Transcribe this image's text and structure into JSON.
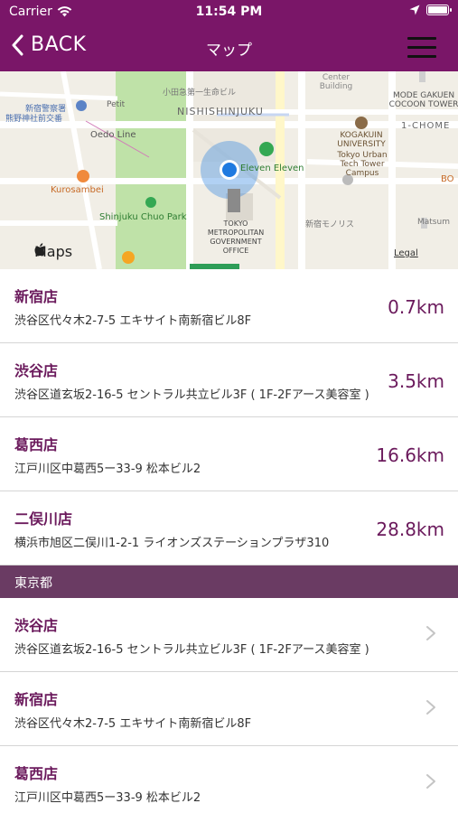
{
  "status_bar": {
    "carrier": "Carrier",
    "time": "11:54 PM"
  },
  "nav": {
    "back_label": "BACK",
    "title": "マップ"
  },
  "map": {
    "labels": {
      "station_police": "新宿警察署",
      "kumano": "熊野神社前交番",
      "petit": "Petit",
      "odakyu": "小田急第一生命ビル",
      "nishishinjuku": "NISHISHINJUKU",
      "center_building": "Center Building",
      "mode_gakuen": "MODE GAKUEN COCOON TOWER",
      "oedo": "Oedo Line",
      "chome": "1-CHOME",
      "kogakuin": "KOGAKUIN UNIVERSITY",
      "tokyo_urban": "Tokyo Urban Tech Tower Campus",
      "eleven": "Eleven Eleven",
      "kurosambei": "Kurosambei",
      "park": "Shinjuku Chuo Park",
      "tmg": "TOKYO METROPOLITAN GOVERNMENT OFFICE",
      "monolith": "新宿モノリス",
      "matsum": "Matsum",
      "bo": "BO",
      "maps": "Maps",
      "legal": "Legal"
    }
  },
  "nearby": [
    {
      "name": "新宿店",
      "address": "渋谷区代々木2-7-5 エキサイト南新宿ビル8F",
      "distance": "0.7km"
    },
    {
      "name": "渋谷店",
      "address": "渋谷区道玄坂2-16-5 セントラル共立ビル3F ( 1F-2Fアース美容室 )",
      "distance": "3.5km"
    },
    {
      "name": "葛西店",
      "address": "江戸川区中葛西5ー33-9 松本ビル2",
      "distance": "16.6km"
    },
    {
      "name": "二俣川店",
      "address": "横浜市旭区二俣川1-2-1 ライオンズステーションプラザ310",
      "distance": "28.8km"
    }
  ],
  "section": {
    "title": "東京都"
  },
  "region_stores": [
    {
      "name": "渋谷店",
      "address": "渋谷区道玄坂2-16-5 セントラル共立ビル3F ( 1F-2Fアース美容室 )"
    },
    {
      "name": "新宿店",
      "address": "渋谷区代々木2-7-5 エキサイト南新宿ビル8F"
    },
    {
      "name": "葛西店",
      "address": "江戸川区中葛西5ー33-9 松本ビル2"
    }
  ],
  "colors": {
    "brand": "#7a1668",
    "section": "#6a3b63",
    "accent_text": "#6b1a5c",
    "location": "#1f7ae0"
  }
}
